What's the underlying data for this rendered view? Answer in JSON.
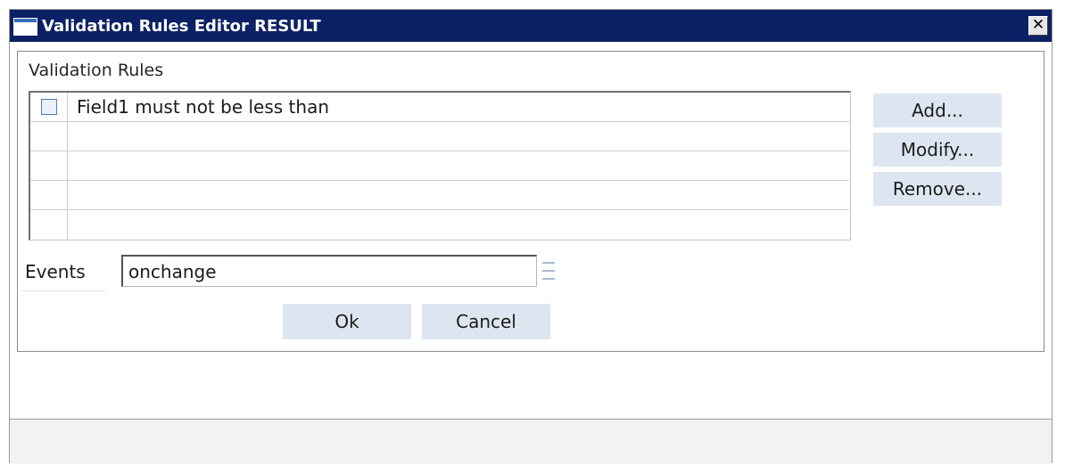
{
  "window": {
    "title": "Validation Rules Editor RESULT",
    "close_glyph": "✕"
  },
  "rules": {
    "label": "Validation Rules",
    "rows": [
      {
        "text": "Field1 must not be less than",
        "checked": false
      },
      {
        "text": ""
      },
      {
        "text": ""
      },
      {
        "text": ""
      },
      {
        "text": ""
      }
    ]
  },
  "buttons": {
    "add": "Add...",
    "modify": "Modify...",
    "remove": "Remove...",
    "ok": "Ok",
    "cancel": "Cancel"
  },
  "events": {
    "label": "Events",
    "value": "onchange",
    "lookup_icon": "list-lookup-icon"
  },
  "colors": {
    "titlebar": "#0c2165",
    "button_bg": "#dde6f0"
  }
}
